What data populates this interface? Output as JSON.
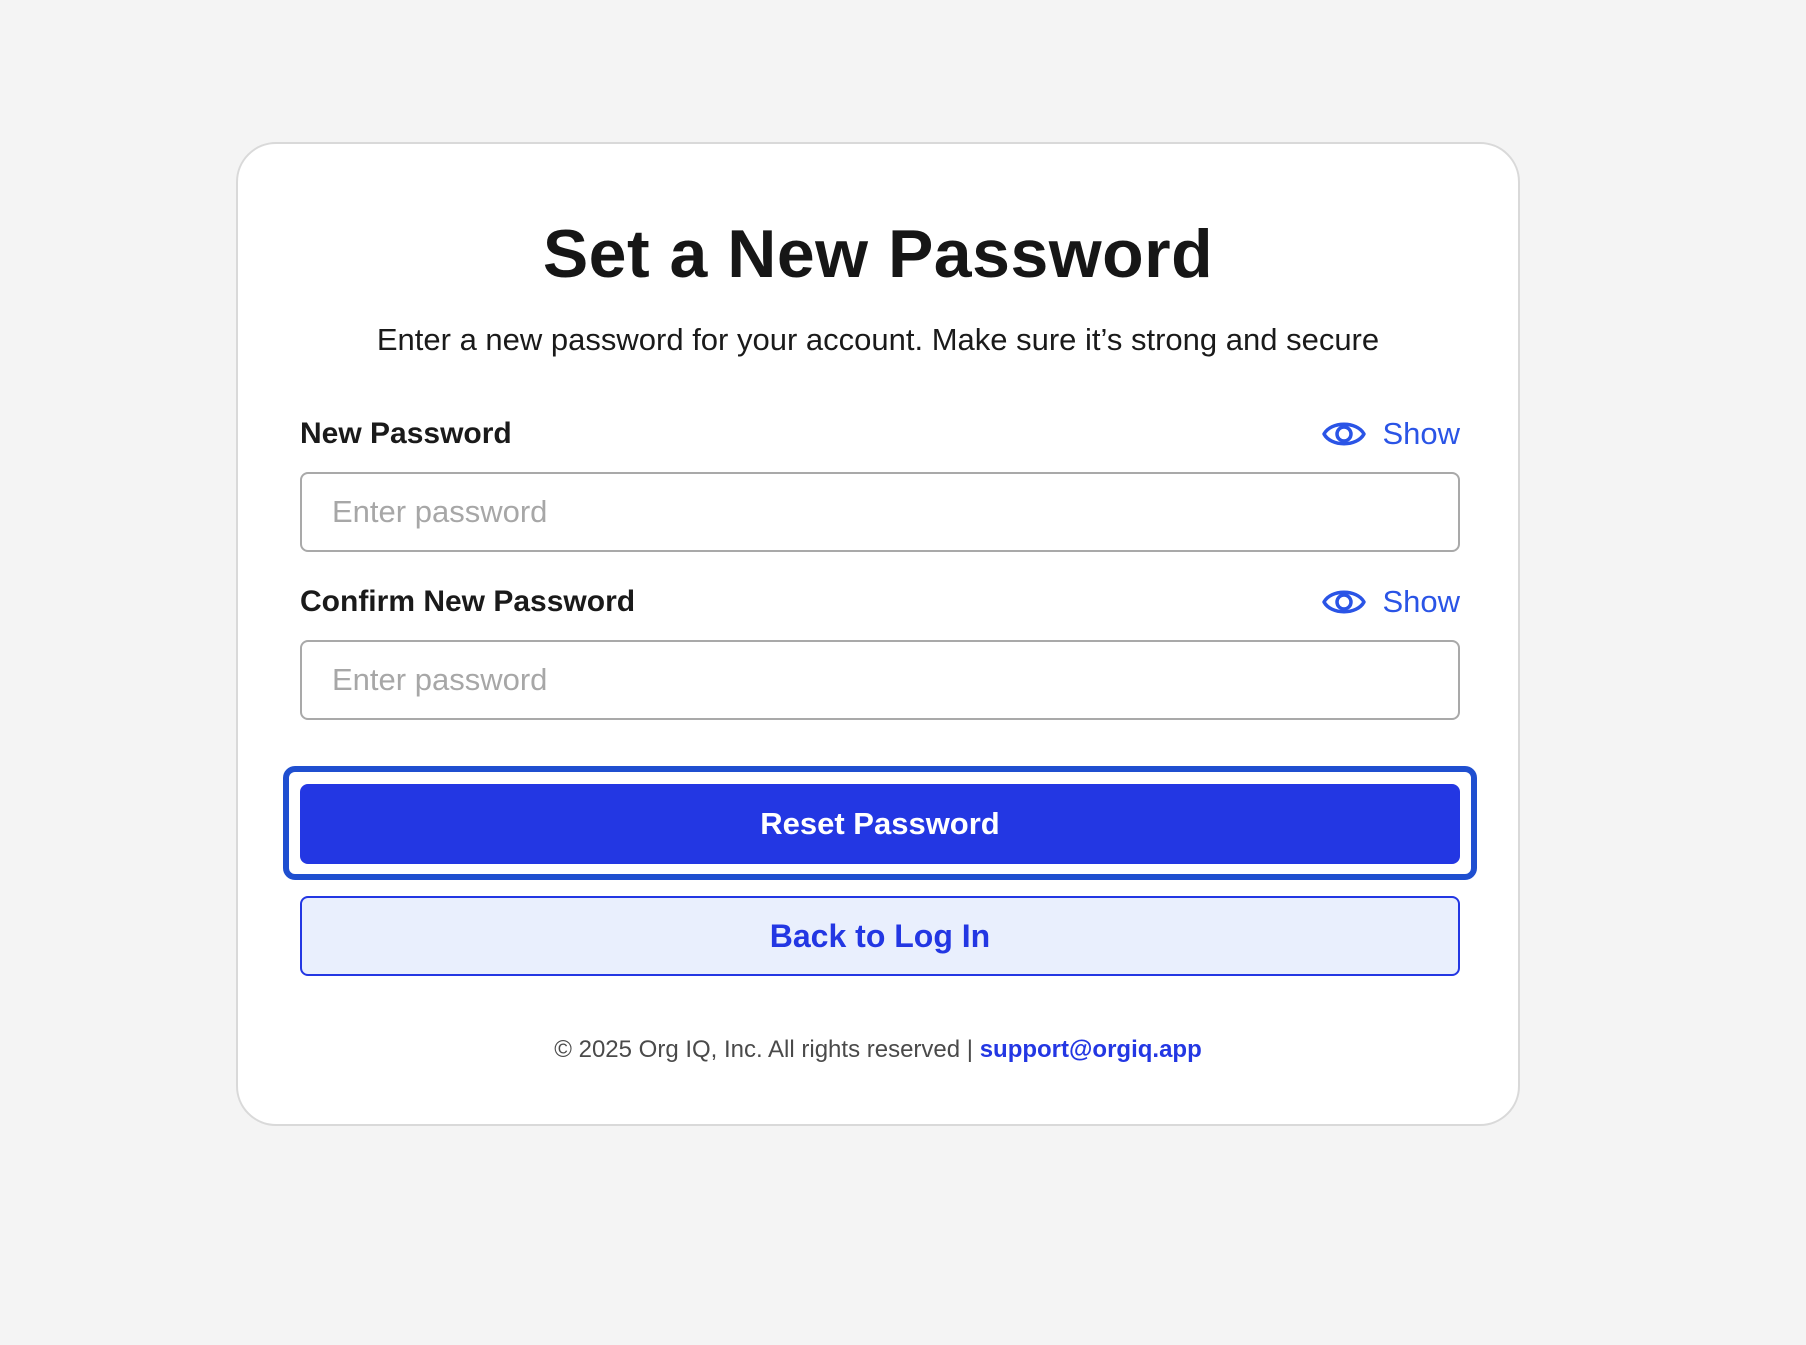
{
  "colors": {
    "page_background": "#f4f4f4",
    "primary": "#2337e3",
    "link": "#2a54e6",
    "secondary_button_bg": "#e9effd",
    "focus_ring": "#1f4fd0"
  },
  "card": {
    "title": "Set a New Password",
    "subtitle": "Enter a new password for your account. Make sure it’s strong and secure"
  },
  "new_password": {
    "label": "New Password",
    "toggle_label": "Show",
    "toggle_icon": "eye-icon",
    "placeholder": "Enter password",
    "value": ""
  },
  "confirm_password": {
    "label": "Confirm New Password",
    "toggle_label": "Show",
    "toggle_icon": "eye-icon",
    "placeholder": "Enter password",
    "value": ""
  },
  "actions": {
    "reset_label": "Reset Password",
    "back_label": "Back to Log In"
  },
  "footer": {
    "copyright": "© 2025 Org IQ, Inc. All rights reserved | ",
    "support_email": "support@orgiq.app"
  }
}
